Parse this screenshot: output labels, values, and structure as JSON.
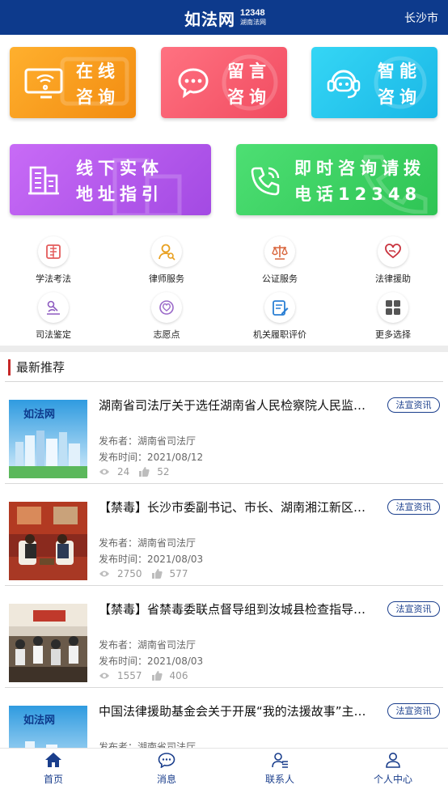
{
  "header": {
    "logo_main": "如法网",
    "logo_number": "12348",
    "logo_sub": "湖南法网",
    "city": "长沙市"
  },
  "quick_actions": [
    {
      "line1": "在线",
      "line2": "咨询",
      "icon": "monitor-wifi-icon"
    },
    {
      "line1": "留言",
      "line2": "咨询",
      "icon": "chat-bubble-icon"
    },
    {
      "line1": "智能",
      "line2": "咨询",
      "icon": "robot-headset-icon"
    },
    {
      "line1": "线下实体",
      "line2": "地址指引",
      "icon": "building-icon"
    },
    {
      "line1": "即时咨询请拨",
      "line2": "电话12348",
      "icon": "phone-icon"
    }
  ],
  "services": [
    {
      "label": "学法考法",
      "icon": "book-icon"
    },
    {
      "label": "律师服务",
      "icon": "lawyer-icon"
    },
    {
      "label": "公证服务",
      "icon": "scales-icon"
    },
    {
      "label": "法律援助",
      "icon": "heart-hand-icon"
    },
    {
      "label": "司法鉴定",
      "icon": "microscope-icon"
    },
    {
      "label": "志愿点",
      "icon": "volunteer-icon"
    },
    {
      "label": "机关履职评价",
      "icon": "edit-document-icon"
    },
    {
      "label": "更多选择",
      "icon": "grid-more-icon"
    }
  ],
  "section": {
    "title": "最新推荐"
  },
  "news": [
    {
      "title": "湖南省司法厅关于选任湖南省人民检察院人民监督员的公告",
      "tag": "法宣资讯",
      "publisher": "发布者：湖南省司法厅",
      "time": "发布时间：2021/08/12",
      "views": "24",
      "likes": "52"
    },
    {
      "title": "【禁毒】长沙市委副书记、市长、湖南湘江新区党工委书记走访",
      "tag": "法宣资讯",
      "publisher": "发布者：湖南省司法厅",
      "time": "发布时间：2021/08/03",
      "views": "2750",
      "likes": "577"
    },
    {
      "title": "【禁毒】省禁毒委联点督导组到汝城县检查指导禁毒工作",
      "tag": "法宣资讯",
      "publisher": "发布者：湖南省司法厅",
      "time": "发布时间：2021/08/03",
      "views": "1557",
      "likes": "406"
    },
    {
      "title": "中国法律援助基金会关于开展“我的法援故事”主题征文活动",
      "tag": "法宣资讯",
      "publisher": "发布者：湖南省司法厅",
      "time": "",
      "views": "",
      "likes": ""
    }
  ],
  "bottom_nav": [
    {
      "label": "首页",
      "icon": "home-icon",
      "active": true
    },
    {
      "label": "消息",
      "icon": "message-icon"
    },
    {
      "label": "联系人",
      "icon": "contacts-icon"
    },
    {
      "label": "个人中心",
      "icon": "user-icon"
    }
  ],
  "colors": {
    "header_bg": "#0d3a8c",
    "accent_blue": "#1a3e8c",
    "section_bar": "#c62828"
  }
}
